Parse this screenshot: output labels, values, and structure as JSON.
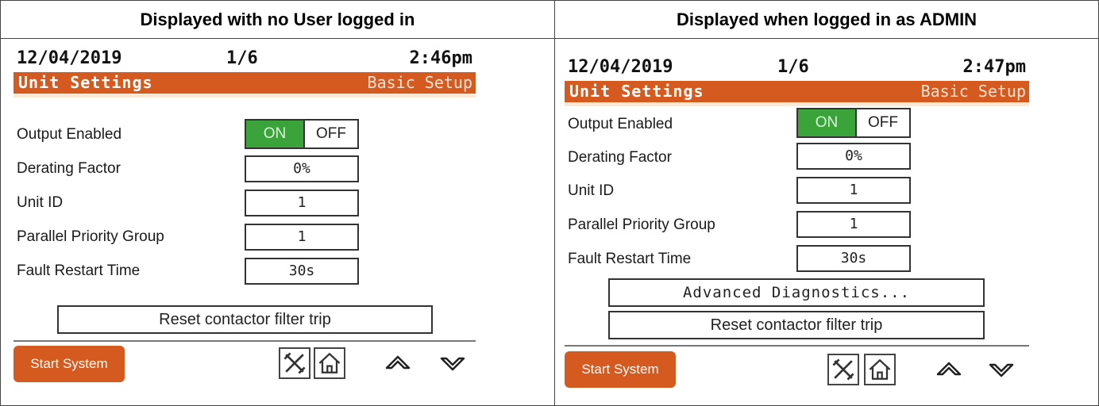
{
  "headers": {
    "left": "Displayed with no User logged in",
    "right": "Displayed when logged in as ADMIN"
  },
  "screens": [
    {
      "date": "12/04/2019",
      "page": "1/6",
      "time": "2:46pm",
      "title": "Unit Settings",
      "section": "Basic Setup",
      "rows": [
        {
          "label": "Output Enabled"
        },
        {
          "label": "Derating Factor",
          "value": "0%"
        },
        {
          "label": "Unit ID",
          "value": "1"
        },
        {
          "label": "Parallel Priority Group",
          "value": "1"
        },
        {
          "label": "Fault Restart Time",
          "value": "30s"
        }
      ],
      "toggle": {
        "on": "ON",
        "off": "OFF"
      },
      "reset_label": "Reset contactor filter trip",
      "start_label": "Start System"
    },
    {
      "date": "12/04/2019",
      "page": "1/6",
      "time": "2:47pm",
      "title": "Unit Settings",
      "section": "Basic Setup",
      "rows": [
        {
          "label": "Output Enabled"
        },
        {
          "label": "Derating Factor",
          "value": "0%"
        },
        {
          "label": "Unit ID",
          "value": "1"
        },
        {
          "label": "Parallel Priority Group",
          "value": "1"
        },
        {
          "label": "Fault Restart Time",
          "value": "30s"
        }
      ],
      "toggle": {
        "on": "ON",
        "off": "OFF"
      },
      "advanced_label": "Advanced Diagnostics...",
      "reset_label": "Reset contactor filter trip",
      "start_label": "Start System"
    }
  ],
  "icons": {
    "tools": "tools-icon",
    "home": "home-icon",
    "up": "chevron-up-icon",
    "down": "chevron-down-icon"
  },
  "colors": {
    "titlebar": "#d45a20",
    "toggle_on": "#3aa33a",
    "start_button": "#d45a20"
  }
}
